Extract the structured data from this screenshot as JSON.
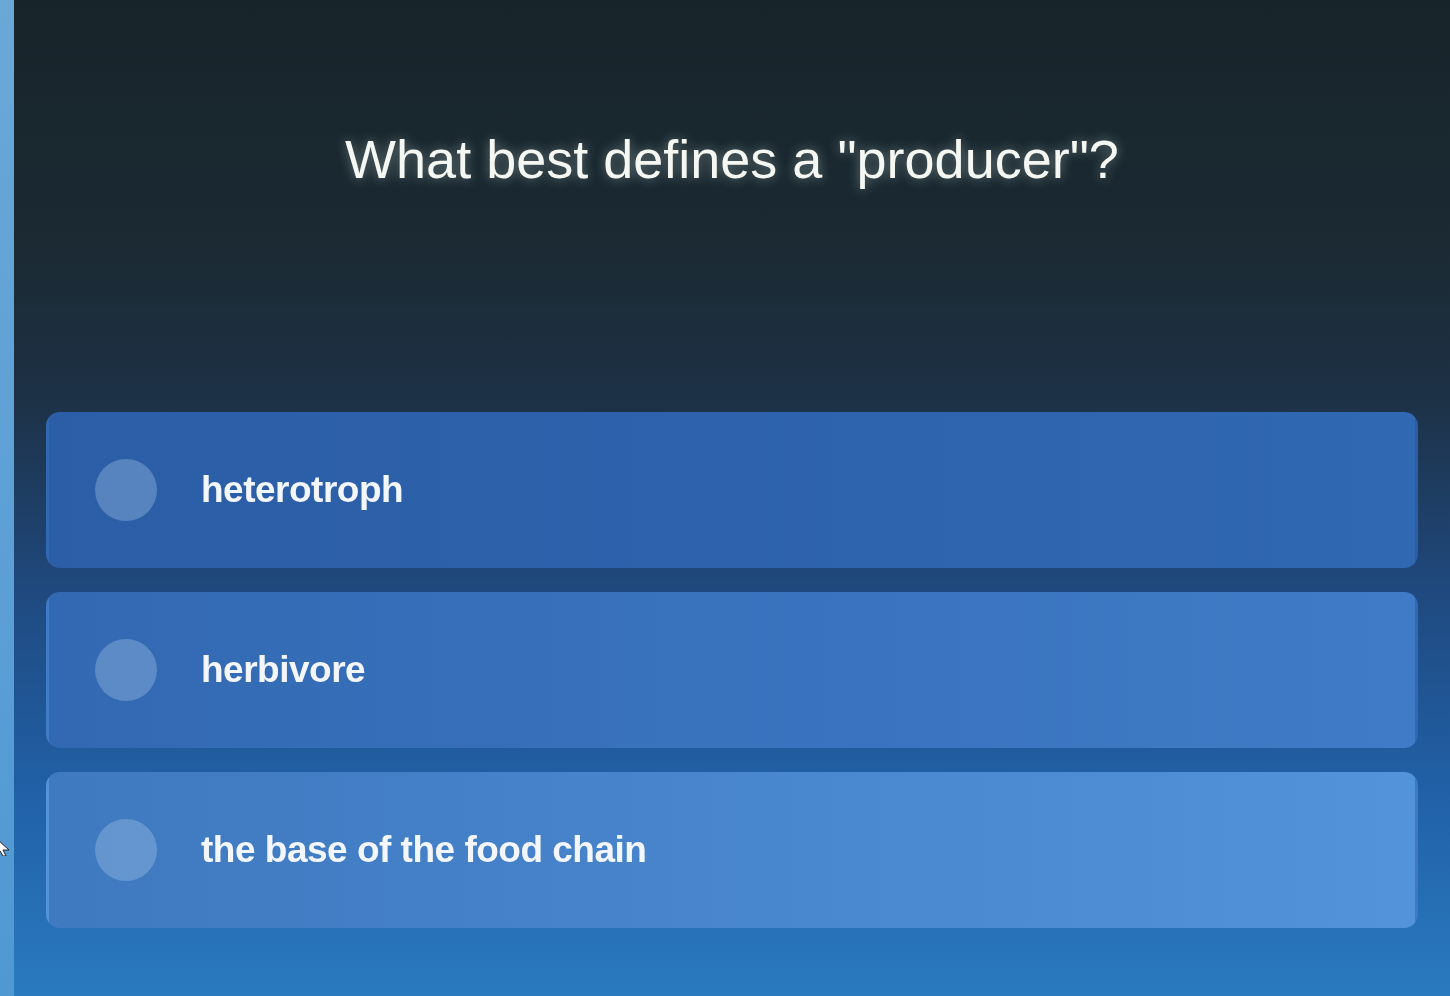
{
  "question": "What best defines a \"producer\"?",
  "options": [
    {
      "label": "heterotroph",
      "selected": false
    },
    {
      "label": "herbivore",
      "selected": false
    },
    {
      "label": "the base of the food chain",
      "selected": false
    }
  ]
}
